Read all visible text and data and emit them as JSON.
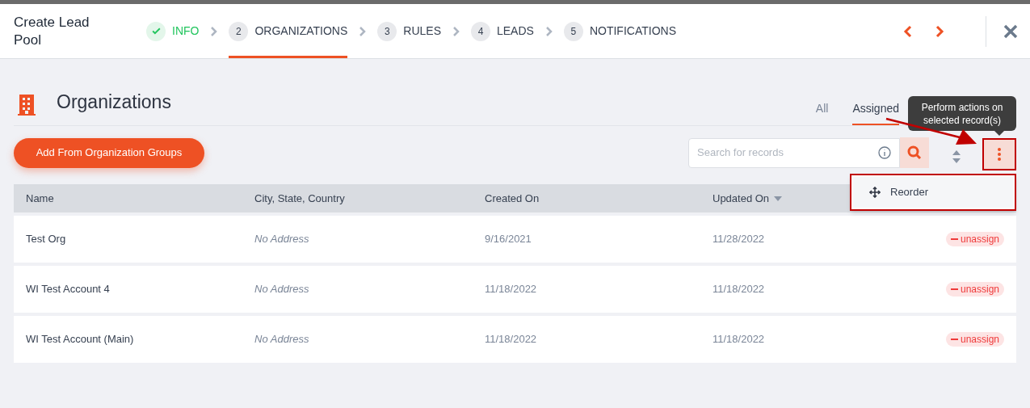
{
  "header": {
    "title": "Create Lead Pool",
    "steps": [
      {
        "label": "INFO",
        "done": true,
        "selected": false
      },
      {
        "number": "2",
        "label": "ORGANIZATIONS",
        "done": false,
        "selected": true
      },
      {
        "number": "3",
        "label": "RULES",
        "done": false,
        "selected": false
      },
      {
        "number": "4",
        "label": "LEADS",
        "done": false,
        "selected": false
      },
      {
        "number": "5",
        "label": "NOTIFICATIONS",
        "done": false,
        "selected": false
      }
    ]
  },
  "section": {
    "title": "Organizations",
    "tabs": [
      {
        "label": "All",
        "selected": false
      },
      {
        "label": "Assigned",
        "selected": true
      }
    ]
  },
  "toolbar": {
    "add_button": "Add From Organization Groups",
    "search": {
      "placeholder": "Search for records"
    },
    "tooltip": "Perform actions on selected record(s)"
  },
  "menu": {
    "items": [
      "Reorder"
    ]
  },
  "table": {
    "columns": [
      {
        "label": "Name",
        "sorted": false
      },
      {
        "label": "City, State, Country",
        "sorted": false
      },
      {
        "label": "Created On",
        "sorted": false
      },
      {
        "label": "Updated On",
        "sorted": true
      }
    ],
    "rows": [
      {
        "name": "Test Org",
        "address": "No Address",
        "created": "9/16/2021",
        "updated": "11/28/2022",
        "action": "unassign"
      },
      {
        "name": "WI Test Account 4",
        "address": "No Address",
        "created": "11/18/2022",
        "updated": "11/18/2022",
        "action": "unassign"
      },
      {
        "name": "WI Test Account (Main)",
        "address": "No Address",
        "created": "11/18/2022",
        "updated": "11/18/2022",
        "action": "unassign"
      }
    ]
  }
}
